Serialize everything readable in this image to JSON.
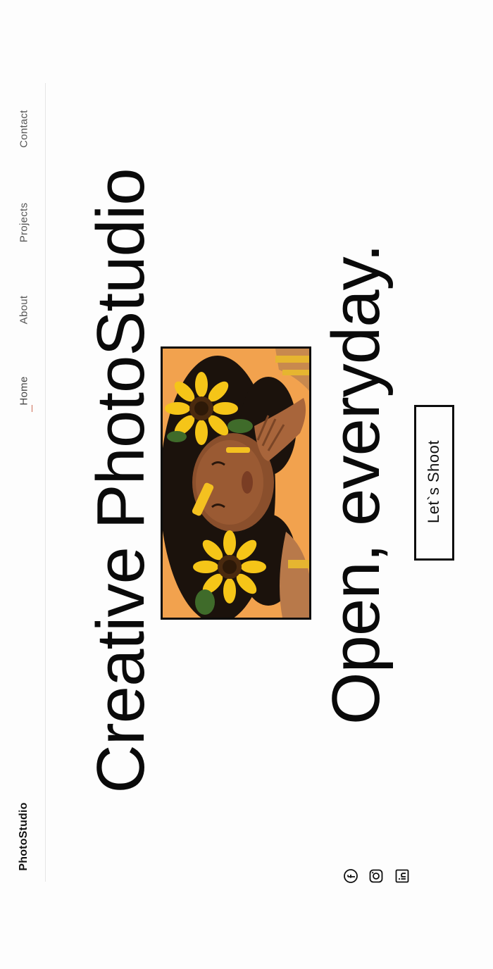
{
  "brand": {
    "name": "PhotoStudio"
  },
  "nav": {
    "items": [
      {
        "label": "Home",
        "active": true
      },
      {
        "label": "About",
        "active": false
      },
      {
        "label": "Projects",
        "active": false
      },
      {
        "label": "Contact",
        "active": false
      }
    ]
  },
  "hero": {
    "title": "Creative PhotoStudio",
    "tagline": "Open, everyday.",
    "cta_label": "Let`s Shoot"
  },
  "social": [
    {
      "icon": "facebook-icon"
    },
    {
      "icon": "instagram-icon"
    },
    {
      "icon": "linkedin-icon"
    }
  ],
  "colors": {
    "background": "#fdfdfd",
    "text": "#0a0a0a",
    "accent": "#cc6b55",
    "photo_background": "#f2a24e",
    "sunflower": "#f5c518"
  }
}
